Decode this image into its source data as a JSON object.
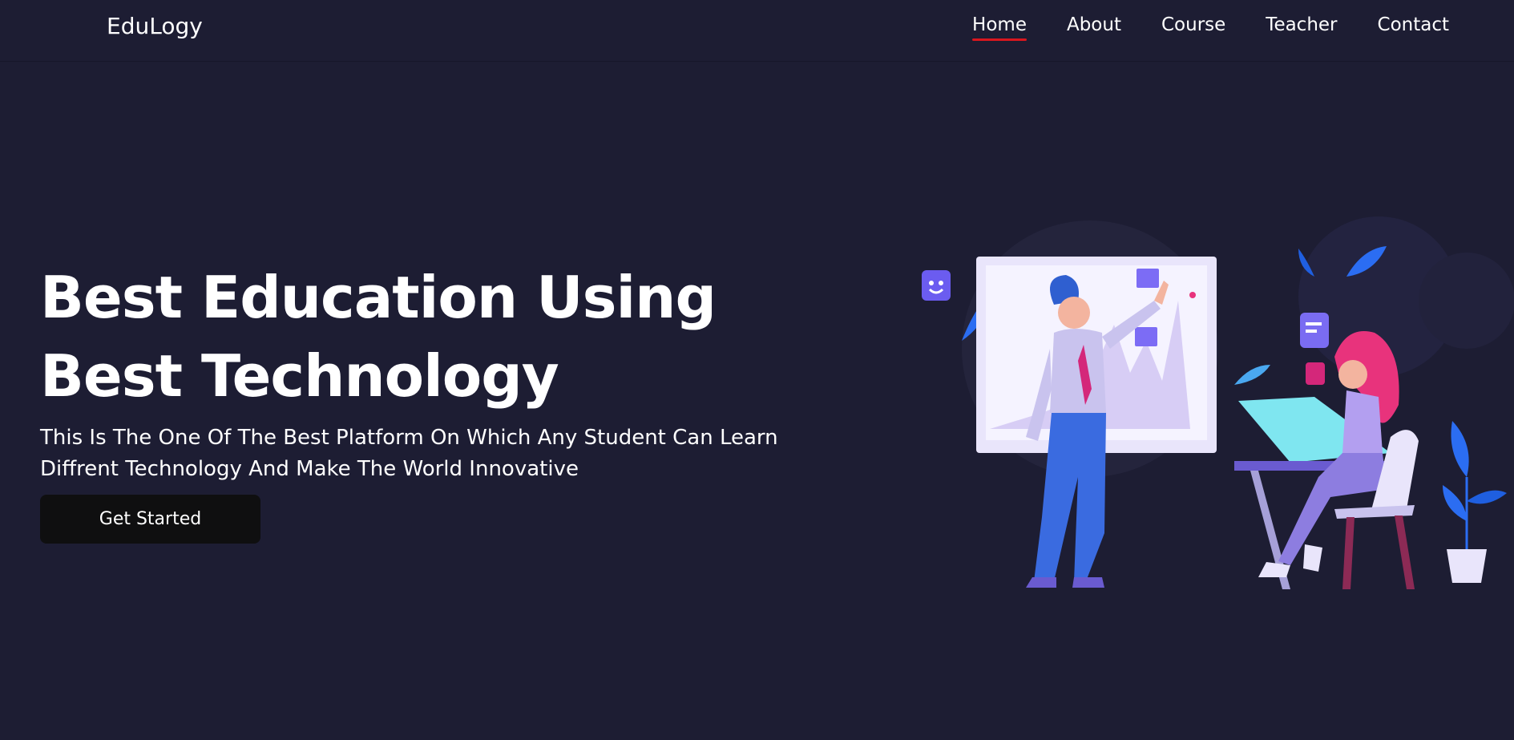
{
  "nav": {
    "brand": "EduLogy",
    "links": [
      {
        "label": "Home",
        "active": true
      },
      {
        "label": "About",
        "active": false
      },
      {
        "label": "Course",
        "active": false
      },
      {
        "label": "Teacher",
        "active": false
      },
      {
        "label": "Contact",
        "active": false
      }
    ]
  },
  "hero": {
    "title_line1": "Best Education Using",
    "title_line2": "Best Technology",
    "subtitle": "This Is The One Of The Best Platform On Which Any Student Can Learn Diffrent Technology And Make The World Innovative",
    "cta_label": "Get Started"
  },
  "colors": {
    "background": "#1d1d33",
    "accent_underline": "#d9161e",
    "button_bg": "#0f0f10"
  }
}
